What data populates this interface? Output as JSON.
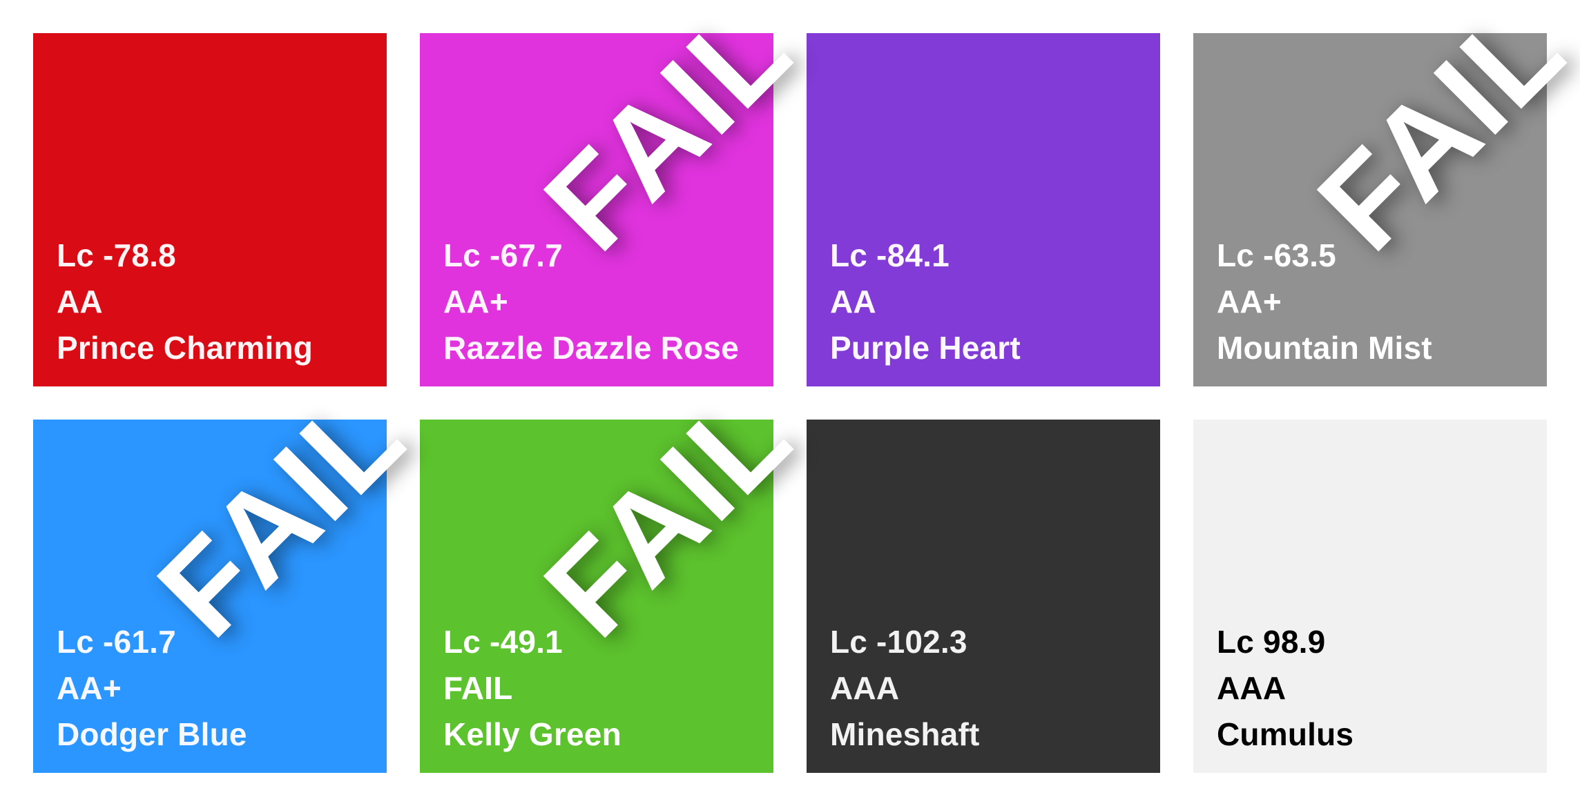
{
  "swatches": [
    {
      "name": "Prince Charming",
      "contrast": "Lc -78.8",
      "rating": "AA",
      "background": "#D90C16",
      "text_color": "#FCF3F4",
      "failed": false
    },
    {
      "name": "Razzle Dazzle Rose",
      "contrast": "Lc -67.7",
      "rating": "AA+",
      "background": "#E033DE",
      "text_color": "#FCF3FC",
      "failed": true
    },
    {
      "name": "Purple Heart",
      "contrast": "Lc -84.1",
      "rating": "AA",
      "background": "#823BD6",
      "text_color": "#FCF6FD",
      "failed": false
    },
    {
      "name": "Mountain Mist",
      "contrast": "Lc -63.5",
      "rating": "AA+",
      "background": "#919191",
      "text_color": "#FFFFFF",
      "failed": true
    },
    {
      "name": "Dodger Blue",
      "contrast": "Lc -61.7",
      "rating": "AA+",
      "background": "#2B96FF",
      "text_color": "#F5F9FF",
      "failed": true
    },
    {
      "name": "Kelly Green",
      "contrast": "Lc -49.1",
      "rating": "FAIL",
      "background": "#5CC22D",
      "text_color": "#FFFFFF",
      "failed": true
    },
    {
      "name": "Mineshaft",
      "contrast": "Lc -102.3",
      "rating": "AAA",
      "background": "#333333",
      "text_color": "#F2F2F2",
      "failed": false
    },
    {
      "name": "Cumulus",
      "contrast": "Lc 98.9",
      "rating": "AAA",
      "background": "#F1F1F1",
      "text_color": "#000000",
      "failed": false
    }
  ],
  "stamp_label": "FAIL"
}
